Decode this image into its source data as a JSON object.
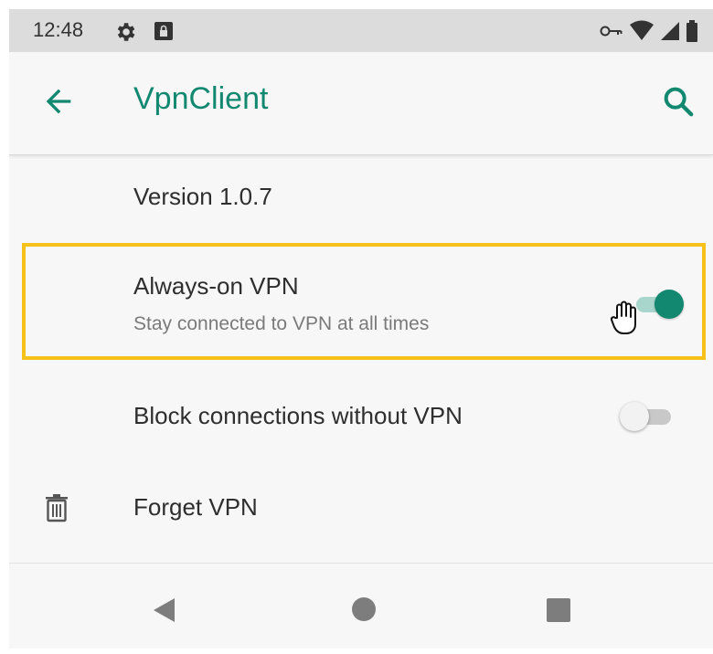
{
  "status_bar": {
    "time": "12:48",
    "icons": [
      "gear-icon",
      "sim-lock-icon",
      "vpn-key-icon",
      "wifi-icon",
      "signal-icon",
      "battery-icon"
    ]
  },
  "app_bar": {
    "title": "VpnClient",
    "icons": [
      "back-arrow-icon",
      "search-icon"
    ]
  },
  "settings": {
    "version": "Version 1.0.7",
    "always_on": {
      "title": "Always-on VPN",
      "subtitle": "Stay connected to VPN at all times",
      "enabled": true
    },
    "block": {
      "title": "Block connections without VPN",
      "enabled": false
    },
    "forget": {
      "title": "Forget VPN",
      "icon": "trash-icon"
    }
  },
  "nav_bar": {
    "icons": [
      "back-triangle-icon",
      "home-circle-icon",
      "recents-square-icon"
    ]
  },
  "colors": {
    "accent": "#128870",
    "highlight": "#f6c21a",
    "status_bar": "#dcdcdc"
  }
}
